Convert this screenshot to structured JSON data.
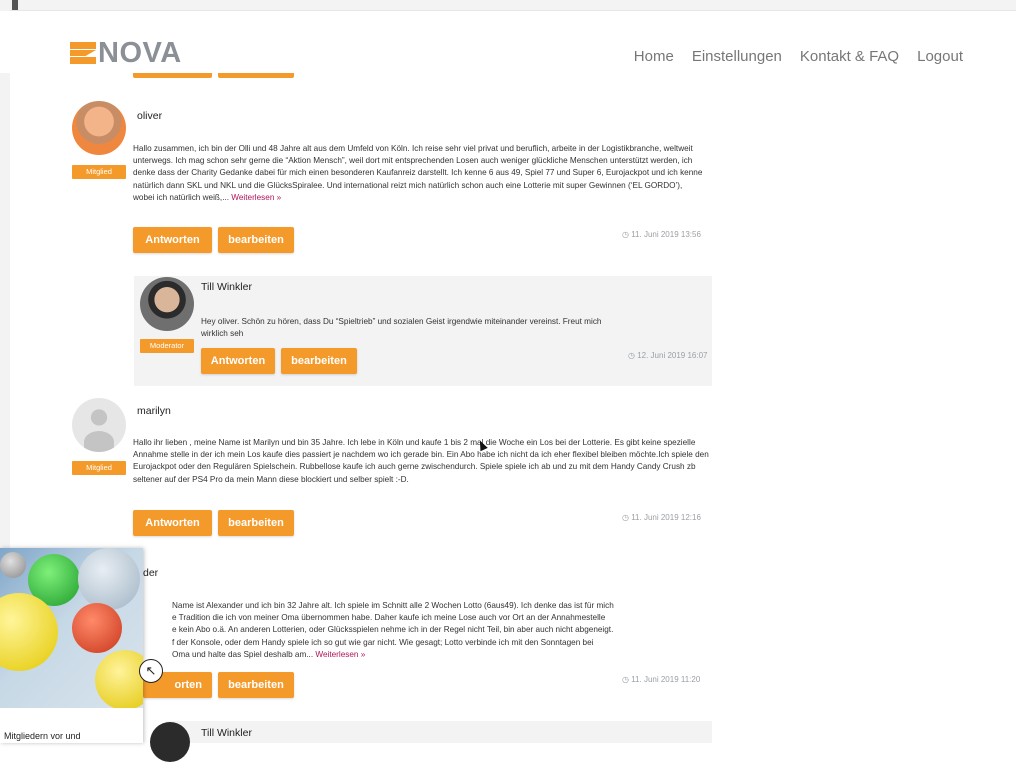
{
  "nav": {
    "logo_text": "NOVA",
    "items": [
      "Home",
      "Einstellungen",
      "Kontakt & FAQ",
      "Logout"
    ]
  },
  "comments": [
    {
      "author": "oliver",
      "role": "Mitglied",
      "text": "Hallo zusammen, ich bin der Olli und 48 Jahre alt aus dem Umfeld von Köln. Ich reise sehr viel privat und beruflich, arbeite in der Logistikbranche, weltweit unterwegs. Ich mag schon sehr gerne die “Aktion Mensch”, weil dort mit entsprechenden Losen auch weniger glückliche Menschen unterstützt werden, ich denke dass der Charity Gedanke dabei für mich einen besonderen Kaufanreiz darstellt. Ich kenne 6 aus 49, Spiel 77 und Super 6, Eurojackpot und ich kenne natürlich dann SKL und NKL und die GlücksSpiralee. Und international reizt mich natürlich schon auch eine Lotterie mit super Gewinnen (‘EL GORDO’), wobei ich natürlich weiß,...",
      "read_more": "Weiterlesen »",
      "reply_label": "Antworten",
      "edit_label": "bearbeiten",
      "date": "11. Juni 2019 13:56"
    },
    {
      "author": "Till Winkler",
      "role": "Moderator",
      "text": "Hey oliver. Schön zu hören, dass Du “Spieltrieb” und sozialen Geist irgendwie miteinander vereinst. Freut mich wirklich seh",
      "reply_label": "Antworten",
      "edit_label": "bearbeiten",
      "date": "12. Juni 2019 16:07"
    },
    {
      "author": "marilyn",
      "role": "Mitglied",
      "text": "Hallo ihr lieben , meine Name ist Marilyn und bin 35 Jahre. Ich lebe in Köln und kaufe 1 bis 2 mal die Woche ein Los bei der Lotterie. Es gibt keine spezielle Annahme stelle in der ich mein Los kaufe dies passiert je nachdem wo ich gerade bin. Ein Abo habe ich nicht da ich eher flexibel bleiben möchte.Ich spiele den Eurojackpot oder den Regulären Spielschein. Rubbellose kaufe ich auch gerne zwischendurch. Spiele spiele ich ab und zu mit dem Handy Candy Crush zb seltener auf der PS4 Pro da mein Mann diese blockiert und selber spielt :-D.",
      "reply_label": "Antworten",
      "edit_label": "bearbeiten",
      "date": "11. Juni 2019 12:16"
    },
    {
      "author_partial": "der",
      "text_lines": [
        "Name ist Alexander und ich bin 32 Jahre alt. Ich spiele im Schnitt alle 2 Wochen Lotto (6aus49). Ich denke das ist für mich",
        "e Tradition die ich von meiner Oma übernommen habe. Daher kaufe ich meine Lose auch vor Ort an der Annahmestelle",
        "e kein Abo o.ä. An anderen Lotterien, oder Glücksspielen nehme ich in der Regel nicht Teil, bin aber auch nicht abgeneigt.",
        "f der Konsole, oder dem Handy spiele ich so gut wie gar nicht. Wie gesagt; Lotto verbinde ich mit den Sonntagen bei",
        "Oma und halte das Spiel deshalb am..."
      ],
      "read_more": "Weiterlesen »",
      "reply_label_partial": "orten",
      "edit_label": "bearbeiten",
      "date": "11. Juni 2019 11:20"
    },
    {
      "author": "Till Winkler"
    }
  ],
  "popup": {
    "text": "Mitgliedern vor und",
    "close_icon": "close-icon"
  },
  "colors": {
    "accent": "#f49a2a",
    "read_more": "#b0145a",
    "logo_grey": "#8b8f96"
  }
}
